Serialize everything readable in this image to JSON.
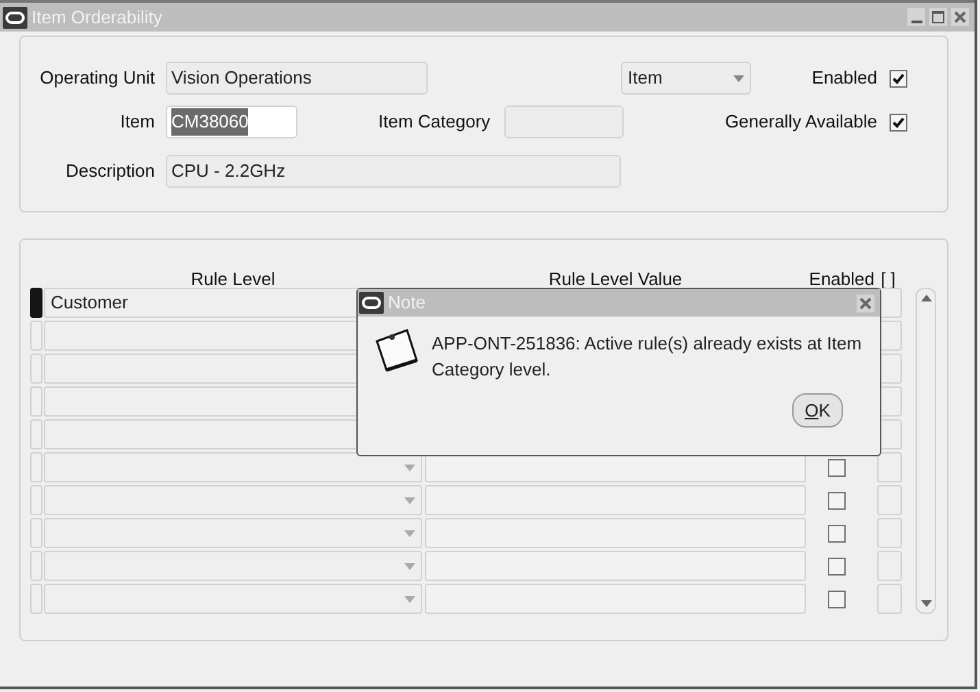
{
  "window": {
    "title": "Item Orderability"
  },
  "header": {
    "operating_unit": {
      "label": "Operating Unit",
      "value": "Vision Operations"
    },
    "level_select": {
      "value": "Item"
    },
    "enabled": {
      "label": "Enabled",
      "checked": true
    },
    "item": {
      "label": "Item",
      "value": "CM38060",
      "highlighted": true
    },
    "item_category": {
      "label": "Item Category"
    },
    "generally_available": {
      "label": "Generally Available",
      "checked": true
    },
    "description": {
      "label": "Description",
      "value": "CPU - 2.2GHz"
    }
  },
  "rules": {
    "columns": [
      "Rule Level",
      "Rule Level Value",
      "Enabled",
      "[ ]"
    ],
    "rows": [
      {
        "rule_level": "Customer",
        "current": true
      },
      {
        "current": false
      },
      {
        "current": false
      },
      {
        "current": false
      },
      {
        "current": false
      },
      {
        "current": false,
        "enabled": false
      },
      {
        "current": false,
        "enabled": false
      },
      {
        "current": false,
        "enabled": false
      },
      {
        "current": false,
        "enabled": false
      },
      {
        "current": false,
        "enabled": false
      }
    ]
  },
  "dialog": {
    "title": "Note",
    "message": "APP-ONT-251836: Active rule(s) already exists at Item Category level.",
    "button": "OK"
  }
}
